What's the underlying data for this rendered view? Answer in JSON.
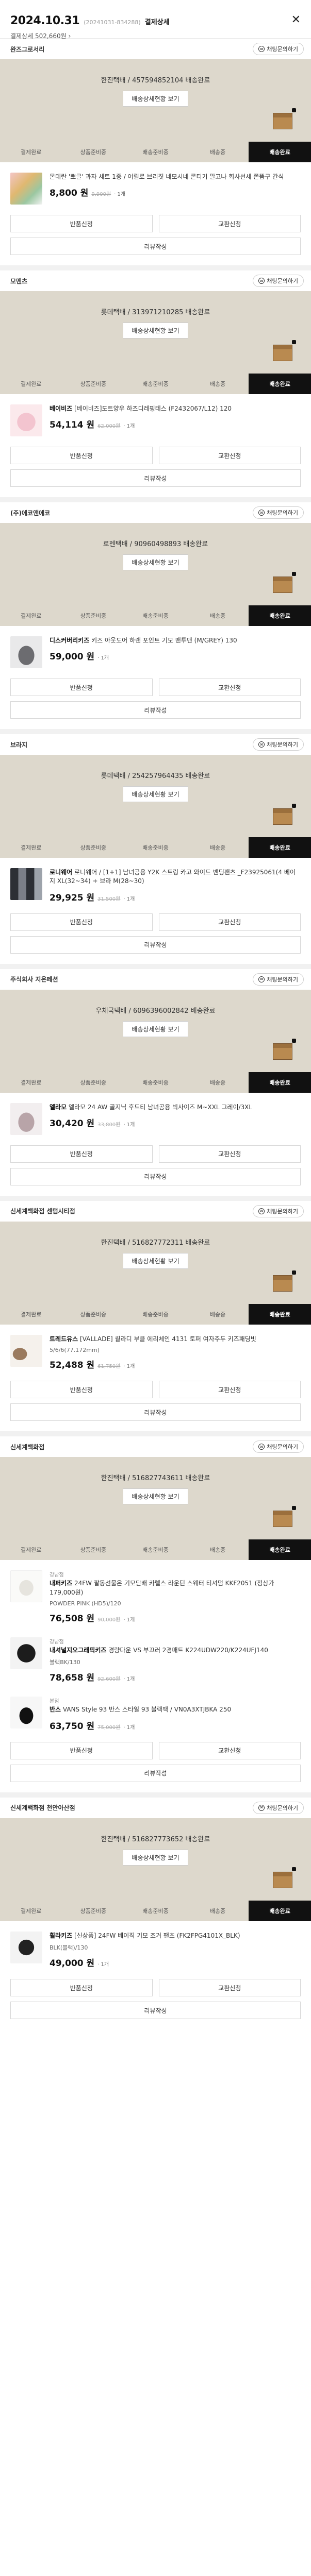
{
  "header": {
    "date": "2024.10.31",
    "order_no": "(20241031-834288)",
    "title": "결제상세",
    "sub": "결제상세 502,660원",
    "sub_arrow": "›",
    "close": "✕"
  },
  "common": {
    "cs_label": "채팅문의하기",
    "track_btn": "배송상세현황 보기",
    "steps": [
      "결제완료",
      "상품준비중",
      "배송준비중",
      "배송중",
      "배송완료"
    ],
    "active_step": 4,
    "btn_exchange_return": "반품신청",
    "btn_exchange": "교환신청",
    "btn_review": "리뷰작성"
  },
  "shops": [
    {
      "name": "완즈그로서리",
      "track": "한진택배 / 457594852104 배송완료",
      "items": [
        {
          "brand": "",
          "name_bold": "",
          "name": "몬테란 '뽀글' 과자 세트 1종 / 어릴로 브리짓 네모시네 콘티기 말고나 회사선세 쫀뜸구 간식",
          "option": "",
          "price": "8,800",
          "orig": "9,900원",
          "qty": "1개",
          "thumb": "t1"
        }
      ]
    },
    {
      "name": "모멘츠",
      "track": "롯데택배 / 313971210285 배송완료",
      "items": [
        {
          "brand": "",
          "name_bold": "베이비즈",
          "name": "[베이비즈]도트양우 하즈디레핑테스 (F2432067/L12) 120",
          "option": "",
          "price": "54,114",
          "orig": "62,000원",
          "qty": "1개",
          "thumb": "t2"
        }
      ]
    },
    {
      "name": "(주)에코앤에코",
      "track": "로젠택배 / 90960498893 배송완료",
      "items": [
        {
          "brand": "",
          "name_bold": "디스커버리키즈",
          "name": "키즈 아웃도어 하랜 포인트 기모 맨투맨 (M/GREY) 130",
          "option": "",
          "price": "59,000",
          "orig": "",
          "qty": "1개",
          "thumb": "t3"
        }
      ]
    },
    {
      "name": "브라지",
      "track": "롯데택배 / 254257964435 배송완료",
      "items": [
        {
          "brand": "",
          "name_bold": "로니웨어",
          "name": "로니웨어 / [1+1] 남녀공용 Y2K 스트링 카고 와이드 밴딩팬츠 _F23925061(4 베이지 XL(32~34) + 브라 M(28~30)",
          "option": "",
          "price": "29,925",
          "orig": "31,500원",
          "qty": "1개",
          "thumb": "t4"
        }
      ]
    },
    {
      "name": "주식회사 지온페션",
      "track": "우체국택배 / 6096396002842 배송완료",
      "items": [
        {
          "brand": "",
          "name_bold": "엘라모",
          "name": "엘라모 24 AW 골지닉 후드티 남녀공용 빅사이즈 M~XXL 그레이/3XL",
          "option": "",
          "price": "30,420",
          "orig": "33,800원",
          "qty": "1개",
          "thumb": "t5"
        }
      ]
    },
    {
      "name": "신세계백화점 센텀시티점",
      "track": "한진택배 / 516827772311 배송완료",
      "items": [
        {
          "brand": "",
          "name_bold": "트레드유스",
          "name": "[VALLADE] 퀼라디 부클 에리체인 4131 토퍼 여자주두 키즈패딩빗",
          "option": "5/6/6(77.172mm)",
          "price": "52,488",
          "orig": "61,750원",
          "qty": "1개",
          "thumb": "t6"
        }
      ]
    },
    {
      "name": "신세계백화점",
      "track": "한진택배 / 516827743611 배송완료",
      "items": [
        {
          "brand": "강남점",
          "name_bold": "내퍼키즈",
          "name": "24FW 팔동선물은 기모단배 카렐스 라운딘 스웨터 티셔덤 KKF2051 (정상가 179,000원)",
          "option": "POWDER PINK (HD5)/120",
          "price": "76,508",
          "orig": "90,000원",
          "qty": "1개",
          "thumb": "t7"
        },
        {
          "brand": "강남점",
          "name_bold": "내셔널지오그래픽키즈",
          "name": "경량다운 VS 부끄러 2경매트 K224UDW220/K224UFJ140",
          "option": "블랙BK/130",
          "price": "78,658",
          "orig": "92,600원",
          "qty": "1개",
          "thumb": "t8"
        },
        {
          "brand": "본점",
          "name_bold": "반스",
          "name": "VANS Style 93 반스 스타일 93 블랙팩 / VN0A3XTJBKA 250",
          "option": "",
          "price": "63,750",
          "orig": "75,000원",
          "qty": "1개",
          "thumb": "t9"
        }
      ]
    },
    {
      "name": "신세계백화점 천안아산점",
      "track": "한진택배 / 516827773652 배송완료",
      "items": [
        {
          "brand": "",
          "name_bold": "휠라키즈",
          "name": "[신상품] 24FW 베이직 기모 조거 팬츠 (FK2FPG4101X_BLK)",
          "option": "BLK(블랙)/130",
          "price": "49,000",
          "orig": "",
          "qty": "1개",
          "thumb": "t10"
        }
      ]
    }
  ]
}
